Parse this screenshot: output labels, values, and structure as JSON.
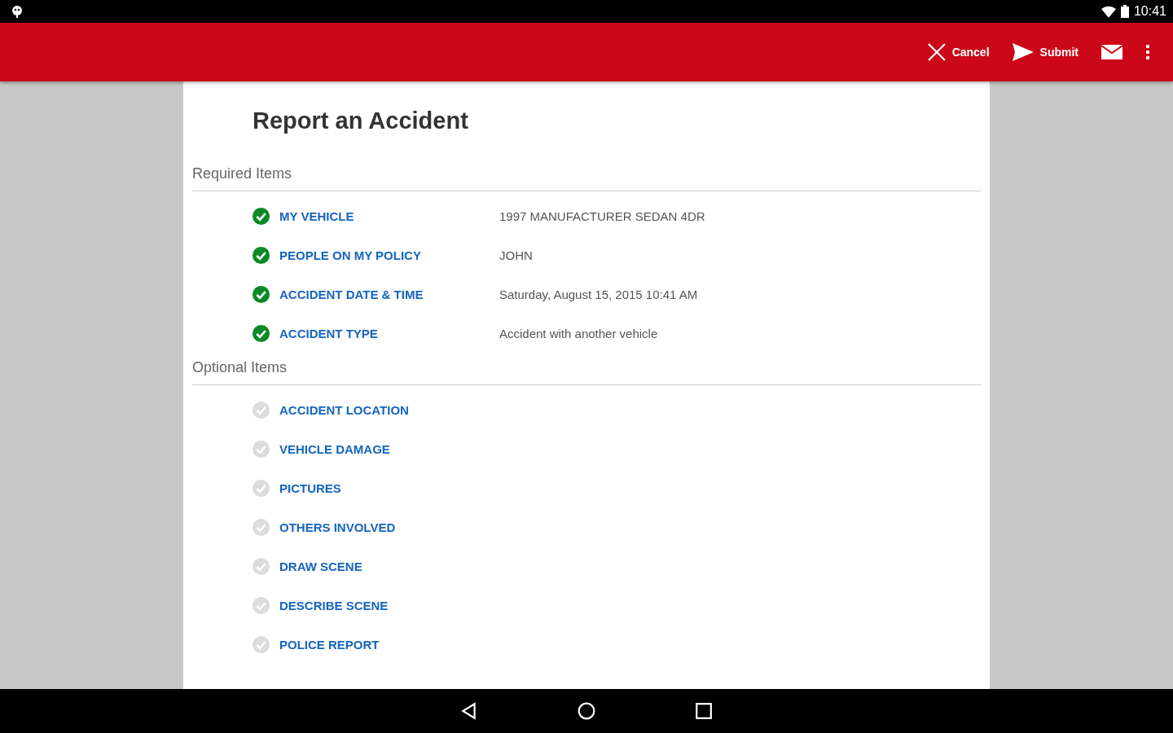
{
  "status_bar": {
    "time": "10:41"
  },
  "app_bar": {
    "actions": [
      {
        "kind": "cancel",
        "label": "Cancel"
      },
      {
        "kind": "submit",
        "label": "Submit"
      },
      {
        "kind": "mail"
      },
      {
        "kind": "more"
      }
    ]
  },
  "title": "Report an Accident",
  "sections": [
    {
      "heading": "Required Items",
      "items": [
        {
          "label": "MY VEHICLE",
          "value": "1997 MANUFACTURER SEDAN 4DR",
          "checked": true
        },
        {
          "label": "PEOPLE ON MY POLICY",
          "value": "JOHN",
          "checked": true
        },
        {
          "label": "ACCIDENT DATE & TIME",
          "value": "Saturday, August 15, 2015 10:41 AM",
          "checked": true
        },
        {
          "label": "ACCIDENT TYPE",
          "value": "Accident with another vehicle",
          "checked": true
        }
      ]
    },
    {
      "heading": "Optional Items",
      "items": [
        {
          "label": "ACCIDENT LOCATION",
          "checked": false
        },
        {
          "label": "VEHICLE DAMAGE",
          "checked": false
        },
        {
          "label": "PICTURES",
          "checked": false
        },
        {
          "label": "OTHERS INVOLVED",
          "checked": false
        },
        {
          "label": "DRAW SCENE",
          "checked": false
        },
        {
          "label": "DESCRIBE SCENE",
          "checked": false
        },
        {
          "label": "POLICE REPORT",
          "checked": false
        }
      ]
    }
  ]
}
